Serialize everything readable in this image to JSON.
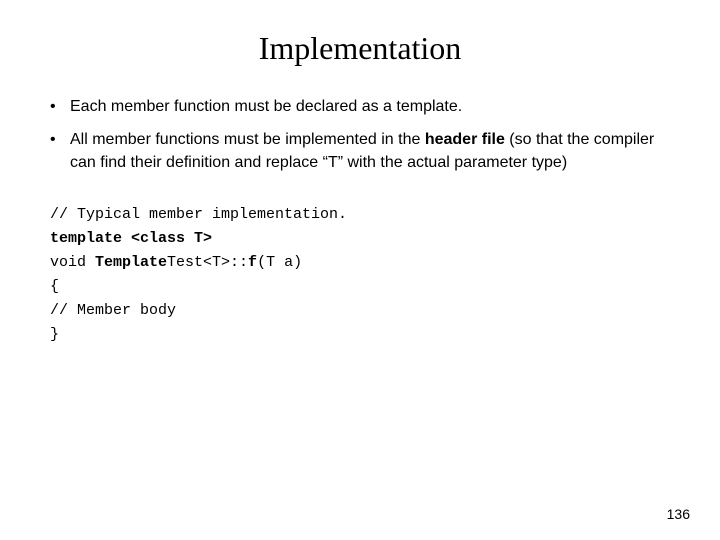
{
  "slide": {
    "title": "Implementation",
    "bullets": [
      {
        "id": "bullet1",
        "text_before_bold": "Each member function must be declared as a template.",
        "bold_text": "",
        "text_after_bold": ""
      },
      {
        "id": "bullet2",
        "text_before_bold": "All member functions must be implemented in the ",
        "bold_text": "header file",
        "text_after_bold": " (so that the compiler can find their definition and replace “T” with the actual parameter type)"
      }
    ],
    "code": {
      "line1_comment": "// Typical member implementation.",
      "line2_bold": "template <class T>",
      "line3_mixed_pre": "void ",
      "line3_bold": "Template",
      "line3_mid": "Test<T>::",
      "line3_bold2": "f",
      "line3_end": "(T a)",
      "line4": "{",
      "line5_indent": "   // Member body",
      "line6": "}"
    },
    "page_number": "136"
  }
}
